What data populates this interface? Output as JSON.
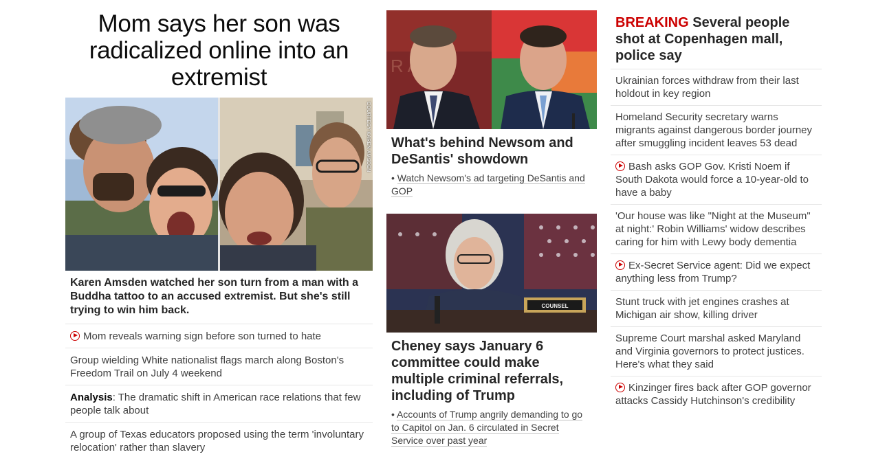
{
  "left": {
    "headline": "Mom says her son was radicalized online into an extremist",
    "photo_credit": "COURTESY KAREN AMSDEN",
    "caption": "Karen Amsden watched her son turn from a man with a Buddha tattoo to an accused extremist. But she's still trying to win him back.",
    "items": [
      {
        "video": true,
        "prefix": "",
        "text": "Mom reveals warning sign before son turned to hate"
      },
      {
        "video": false,
        "prefix": "",
        "text": "Group wielding White nationalist flags march along Boston's Freedom Trail on July 4 weekend"
      },
      {
        "video": false,
        "prefix": "Analysis",
        "text": ": The dramatic shift in American race relations that few people talk about"
      },
      {
        "video": false,
        "prefix": "",
        "text": "A group of Texas educators proposed using the term 'involuntary relocation' rather than slavery"
      }
    ]
  },
  "middle": {
    "story1": {
      "headline": "What's behind Newsom and DeSantis' showdown",
      "bullet": "•",
      "link": "Watch Newsom's ad targeting DeSantis and GOP"
    },
    "story2": {
      "headline": "Cheney says January 6 committee could make multiple criminal referrals, including of Trump",
      "bullet": "•",
      "link": "Accounts of Trump angrily demanding to go to Capitol on Jan. 6 circulated in Secret Service over past year",
      "placard": "COUNSEL"
    }
  },
  "right": {
    "breaking_tag": "BREAKING",
    "breaking_text": "Several people shot at Copenhagen mall, police say",
    "items": [
      {
        "video": false,
        "text": "Ukrainian forces withdraw from their last holdout in key region"
      },
      {
        "video": false,
        "text": "Homeland Security secretary warns migrants against dangerous border journey after smuggling incident leaves 53 dead"
      },
      {
        "video": true,
        "text": "Bash asks GOP Gov. Kristi Noem if South Dakota would force a 10-year-old to have a baby"
      },
      {
        "video": false,
        "text": "'Our house was like \"Night at the Museum\" at night:' Robin Williams' widow describes caring for him with Lewy body dementia"
      },
      {
        "video": true,
        "text": "Ex-Secret Service agent: Did we expect anything less from Trump?"
      },
      {
        "video": false,
        "text": "Stunt truck with jet engines crashes at Michigan air show, killing driver"
      },
      {
        "video": false,
        "text": "Supreme Court marshal asked Maryland and Virginia governors to protect justices. Here's what they said"
      },
      {
        "video": true,
        "text": "Kinzinger fires back after GOP governor attacks Cassidy Hutchinson's credibility"
      }
    ]
  },
  "colors": {
    "accent": "#cc0000",
    "text": "#262626",
    "divider": "#e6e6e6"
  }
}
